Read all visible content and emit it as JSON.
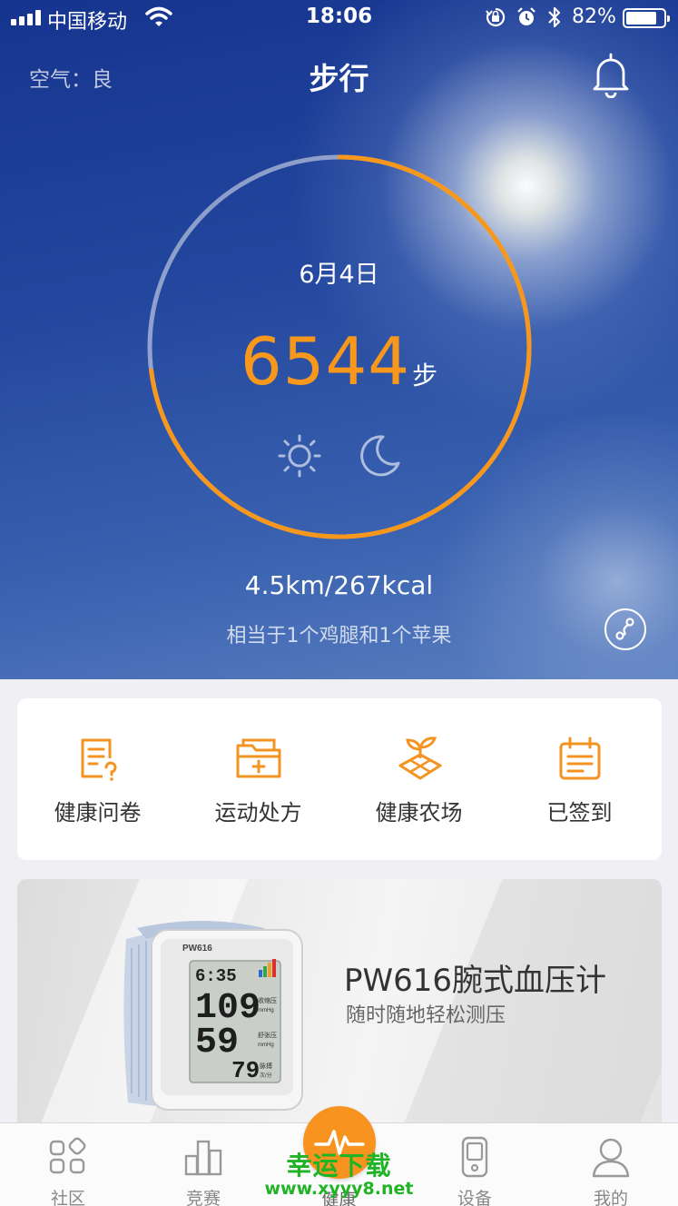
{
  "status_bar": {
    "carrier": "中国移动",
    "time": "18:06",
    "battery_percent": "82%",
    "battery_level": 0.82,
    "icons": [
      "signal-icon",
      "wifi-icon",
      "orientation-lock-icon",
      "alarm-icon",
      "bluetooth-icon",
      "battery-icon"
    ]
  },
  "header": {
    "air_quality": "空气：良",
    "title": "步行",
    "notification_icon": "bell-icon"
  },
  "activity": {
    "date": "6月4日",
    "steps": "6544",
    "steps_unit": "步",
    "goal_progress": 0.73,
    "ring_color": "#f7981d",
    "mode_icons": [
      "sun-icon",
      "moon-icon"
    ],
    "distance_calories": "4.5km/267kcal",
    "equivalent": "相当于1个鸡腿和1个苹果",
    "route_icon": "route-icon"
  },
  "quick_actions": [
    {
      "label": "健康问卷",
      "icon": "questionnaire-icon"
    },
    {
      "label": "运动处方",
      "icon": "prescription-folder-icon"
    },
    {
      "label": "健康农场",
      "icon": "farm-sprout-icon"
    },
    {
      "label": "已签到",
      "icon": "checkin-calendar-icon"
    }
  ],
  "banner": {
    "title": "PW616腕式血压计",
    "subtitle": "随时随地轻松测压",
    "device": {
      "model": "PW616",
      "time": "6:35",
      "systolic": "109",
      "diastolic": "59",
      "pulse": "79",
      "systolic_label": "收缩压",
      "diastolic_label": "舒张压",
      "pulse_label": "脉搏",
      "unit_mmhg": "mmHg",
      "unit_pulse": "次/分"
    }
  },
  "tab_bar": {
    "accent": "#f7931e",
    "tabs": [
      {
        "label": "社区",
        "icon": "community-icon"
      },
      {
        "label": "竞赛",
        "icon": "competition-icon"
      },
      {
        "label": "健康",
        "icon": "health-pulse-icon",
        "active": true
      },
      {
        "label": "设备",
        "icon": "device-icon"
      },
      {
        "label": "我的",
        "icon": "profile-icon"
      }
    ]
  },
  "watermark": {
    "text": "幸运下载",
    "url": "www.xyyy8.net"
  }
}
